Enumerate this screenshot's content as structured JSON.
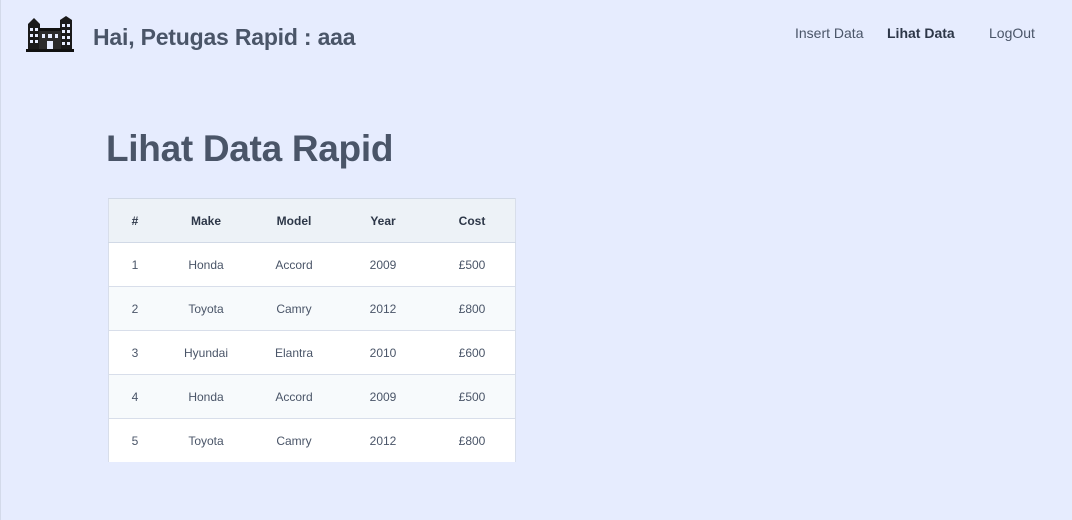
{
  "header": {
    "greeting": "Hai, Petugas Rapid : aaa",
    "logo_icon": "building-icon",
    "nav": [
      {
        "label": "Insert Data",
        "active": false
      },
      {
        "label": "Lihat Data",
        "active": true
      },
      {
        "label": "LogOut",
        "active": false
      }
    ]
  },
  "main": {
    "title": "Lihat Data Rapid",
    "table": {
      "columns": [
        "#",
        "Make",
        "Model",
        "Year",
        "Cost"
      ],
      "rows": [
        [
          "1",
          "Honda",
          "Accord",
          "2009",
          "£500"
        ],
        [
          "2",
          "Toyota",
          "Camry",
          "2012",
          "£800"
        ],
        [
          "3",
          "Hyundai",
          "Elantra",
          "2010",
          "£600"
        ],
        [
          "4",
          "Honda",
          "Accord",
          "2009",
          "£500"
        ],
        [
          "5",
          "Toyota",
          "Camry",
          "2012",
          "£800"
        ]
      ]
    }
  },
  "colors": {
    "background": "#e6ecfe",
    "text": "#4a5568",
    "table_header_bg": "#edf2f7",
    "table_row_alt_bg": "#f7fafc"
  }
}
